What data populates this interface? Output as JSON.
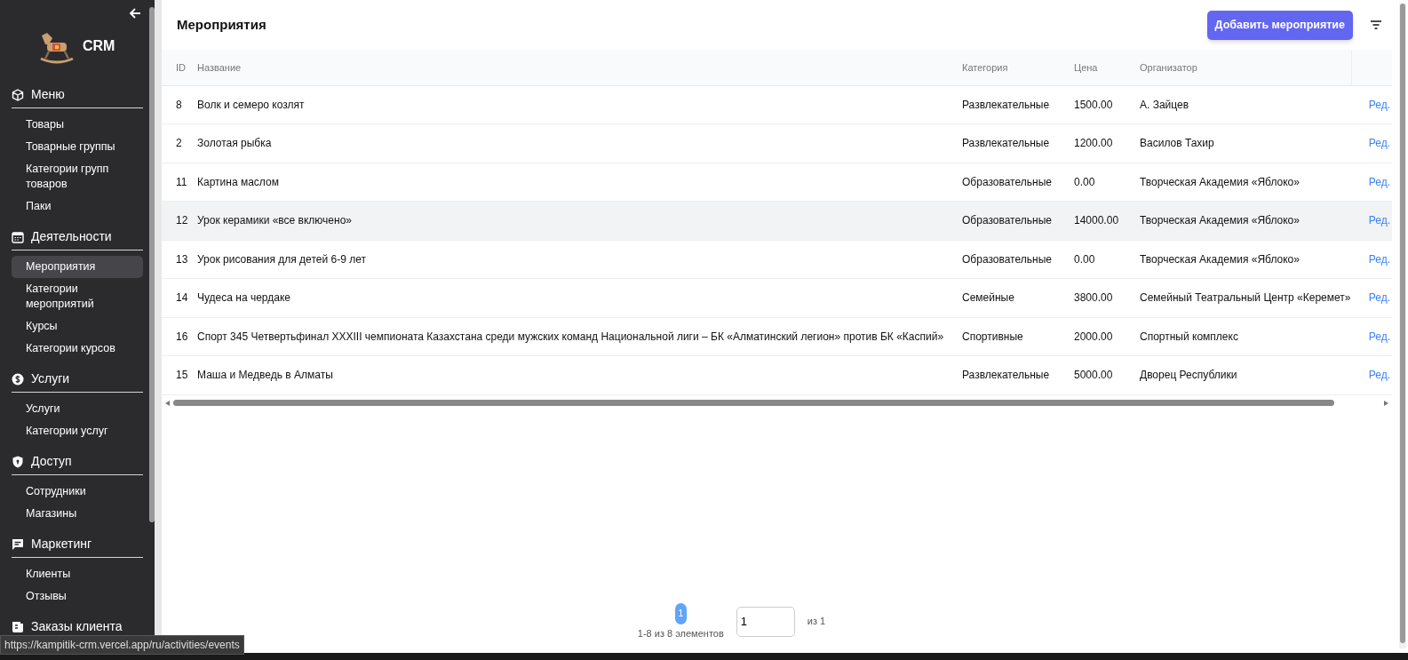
{
  "sidebar": {
    "logo_text": "CRM",
    "sections": [
      {
        "title": "Меню",
        "items": [
          {
            "label": "Товары",
            "selected": false
          },
          {
            "label": "Товарные группы",
            "selected": false
          },
          {
            "label": "Категории групп товаров",
            "selected": false
          },
          {
            "label": "Паки",
            "selected": false
          }
        ]
      },
      {
        "title": "Деятельности",
        "items": [
          {
            "label": "Мероприятия",
            "selected": true
          },
          {
            "label": "Категории мероприятий",
            "selected": false
          },
          {
            "label": "Курсы",
            "selected": false
          },
          {
            "label": "Категории курсов",
            "selected": false
          }
        ]
      },
      {
        "title": "Услуги",
        "items": [
          {
            "label": "Услуги",
            "selected": false
          },
          {
            "label": "Категории услуг",
            "selected": false
          }
        ]
      },
      {
        "title": "Доступ",
        "items": [
          {
            "label": "Сотрудники",
            "selected": false
          },
          {
            "label": "Магазины",
            "selected": false
          }
        ]
      },
      {
        "title": "Маркетинг",
        "items": [
          {
            "label": "Клиенты",
            "selected": false
          },
          {
            "label": "Отзывы",
            "selected": false
          }
        ]
      },
      {
        "title": "Заказы клиента"
      }
    ]
  },
  "page": {
    "title": "Мероприятия",
    "add_button": "Добавить мероприятие"
  },
  "table": {
    "columns": [
      "ID",
      "Название",
      "Категория",
      "Цена",
      "Организатор"
    ],
    "rows": [
      {
        "cells": [
          "8",
          "Волк и семеро козлят",
          "Развлекательные",
          "1500.00",
          "А. Зайцев"
        ],
        "action": "Ред.",
        "hovered": false
      },
      {
        "cells": [
          "2",
          "Золотая рыбка",
          "Развлекательные",
          "1200.00",
          "Василов Тахир"
        ],
        "action": "Ред.",
        "hovered": false
      },
      {
        "cells": [
          "11",
          "Картина маслом",
          "Образовательные",
          "0.00",
          "Творческая Академия «Яблоко»"
        ],
        "action": "Ред.",
        "hovered": false
      },
      {
        "cells": [
          "12",
          "Урок керамики «все включено»",
          "Образовательные",
          "14000.00",
          "Творческая Академия «Яблоко»"
        ],
        "action": "Ред.",
        "hovered": true
      },
      {
        "cells": [
          "13",
          "Урок рисования для детей 6-9 лет",
          "Образовательные",
          "0.00",
          "Творческая Академия «Яблоко»"
        ],
        "action": "Ред.",
        "hovered": false
      },
      {
        "cells": [
          "14",
          "Чудеса на чердаке",
          "Семейные",
          "3800.00",
          "Семейный Театральный Центр «Керемет»"
        ],
        "action": "Ред.",
        "hovered": false
      },
      {
        "cells": [
          "16",
          "Спорт 345 Четвертьфинал XXXIII чемпионата Казахстана среди мужских команд Национальной лиги – БК «Алматинский легион» против БК «Каспий»",
          "Спортивные",
          "2000.00",
          "Спортный комплекс"
        ],
        "action": "Ред.",
        "hovered": false
      },
      {
        "cells": [
          "15",
          "Маша и Медведь в Алматы",
          "Развлекательные",
          "5000.00",
          "Дворец Республики"
        ],
        "action": "Ред.",
        "hovered": false
      }
    ]
  },
  "pagination": {
    "pages": [
      {
        "label": "1",
        "selected": true
      }
    ],
    "summary": "1-8 из 8 элементов",
    "page_input": "1",
    "total": "из 1"
  },
  "status_url": "https://kampitik-crm.vercel.app/ru/activities/events"
}
